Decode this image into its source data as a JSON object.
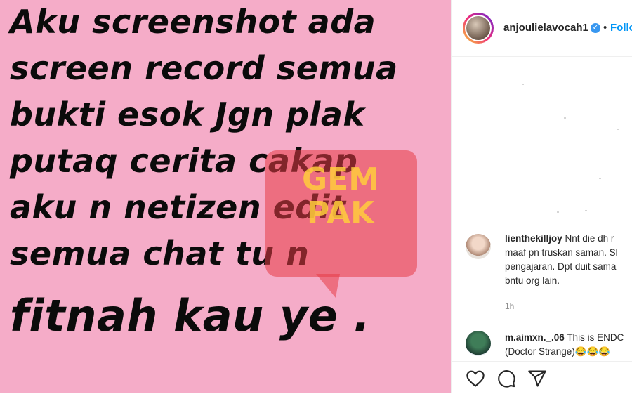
{
  "post": {
    "story_lines": [
      "Aku screenshot ada",
      "screen record semua",
      "bukti esok Jgn plak",
      "putaq cerita cakap",
      "aku n netizen edit",
      "semua chat tu n",
      "fitnah kau ye ."
    ],
    "background_color": "#f5acc8",
    "watermark_lines": [
      "GEM",
      "PAK"
    ]
  },
  "header": {
    "username": "anjoulielavocah1",
    "verified_icon": "verified-badge-icon",
    "separator": "•",
    "follow_label": "Follo"
  },
  "comments": [
    {
      "username": "lienthekilljoy",
      "lines": [
        "Nnt die dh r",
        "maaf pn truskan saman. Sl",
        "pengajaran. Dpt duit sama",
        "bntu org lain."
      ],
      "time": "1h"
    },
    {
      "username": "m.aimxn._.06",
      "lines": [
        "This is ENDC",
        "(Doctor Strange)😂😂😂"
      ]
    }
  ],
  "actions": {
    "icons": [
      "heart-icon",
      "comment-icon",
      "share-icon"
    ]
  },
  "colors": {
    "accent": "#0095f6",
    "verified": "#3897f0"
  }
}
